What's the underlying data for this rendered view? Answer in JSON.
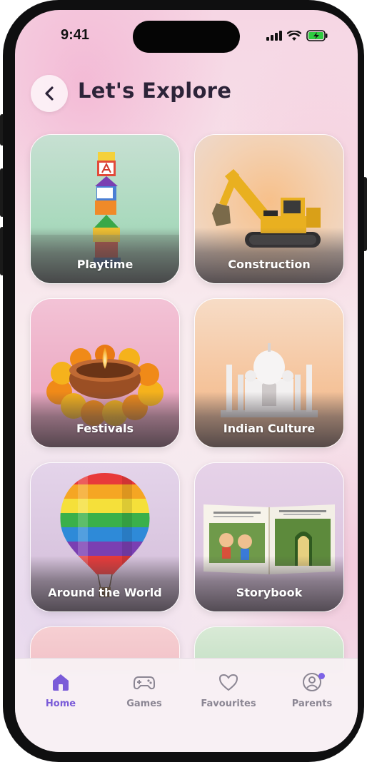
{
  "status_bar": {
    "time": "9:41"
  },
  "header": {
    "title": "Let's Explore",
    "back_icon": "chevron-left-icon"
  },
  "categories": [
    {
      "label": "Playtime",
      "illustration": "stacked-toy-blocks"
    },
    {
      "label": "Construction",
      "illustration": "yellow-excavator"
    },
    {
      "label": "Festivals",
      "illustration": "diya-with-marigold"
    },
    {
      "label": "Indian Culture",
      "illustration": "taj-mahal"
    },
    {
      "label": "Around the World",
      "illustration": "hot-air-balloon"
    },
    {
      "label": "Storybook",
      "illustration": "open-picture-book"
    }
  ],
  "tab_bar": {
    "tabs": [
      {
        "label": "Home",
        "icon": "home-icon",
        "active": true
      },
      {
        "label": "Games",
        "icon": "gamepad-icon",
        "active": false
      },
      {
        "label": "Favourites",
        "icon": "heart-icon",
        "active": false
      },
      {
        "label": "Parents",
        "icon": "user-circle-icon",
        "active": false,
        "notification_dot": true
      }
    ]
  },
  "colors": {
    "accent": "#7a5bd8",
    "title": "#2c2338",
    "inactive_tab": "#8b8693",
    "battery": "#2ecc40"
  }
}
